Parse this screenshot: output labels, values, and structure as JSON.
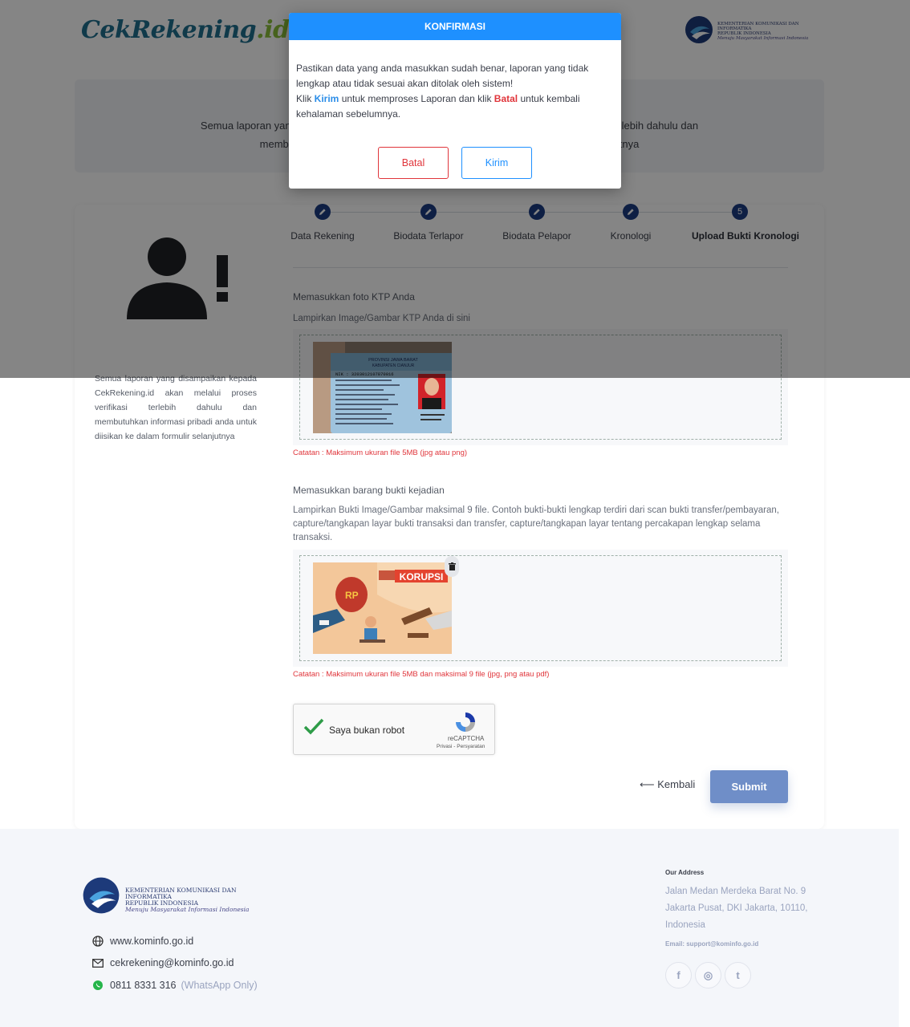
{
  "header": {
    "logo_main": "CekRekening",
    "logo_suffix": ".id",
    "ministry_line1": "KEMENTERIAN KOMUNIKASI DAN INFORMATIKA",
    "ministry_line2": "REPUBLIK INDONESIA",
    "ministry_slogan": "Menuju Masyarakat Informasi Indonesia"
  },
  "banner": {
    "line1_start": "Semua laporan yan",
    "line1_end": "lebih dahulu dan",
    "line2_start": "memb",
    "line2_end": "tnya"
  },
  "sidebar": {
    "text": "Semua laporan yang disampaikan kepada CekRekening.id akan melalui proses verifikasi terlebih dahulu dan membutuhkan informasi pribadi anda untuk diisikan ke dalam formulir selanjutnya"
  },
  "stepper": {
    "steps": [
      {
        "label": "Data Rekening",
        "state": "done"
      },
      {
        "label": "Biodata Terlapor",
        "state": "done"
      },
      {
        "label": "Biodata Pelapor",
        "state": "done"
      },
      {
        "label": "Kronologi",
        "state": "done"
      },
      {
        "label": "Upload Bukti Kronologi",
        "state": "active",
        "number": "5"
      }
    ]
  },
  "ktp": {
    "title": "Memasukkan foto KTP Anda",
    "desc": "Lampirkan Image/Gambar KTP Anda di sini",
    "note": "Catatan : Maksimum ukuran file 5MB (jpg atau png)",
    "card_header": "PROVINSI JAWA BARAT",
    "card_sub": "KABUPATEN CIANJUR",
    "card_nik": "NIK   :  3203012107870016"
  },
  "evidence": {
    "title": "Memasukkan barang bukti kejadian",
    "desc": "Lampirkan Bukti Image/Gambar maksimal 9 file. Contoh bukti-bukti lengkap terdiri dari scan bukti transfer/pembayaran, capture/tangkapan layar bukti transaksi dan transfer, capture/tangkapan layar tentang percakapan lengkap selama transaksi.",
    "note": "Catatan : Maksimum ukuran file 5MB dan maksimal 9 file (jpg, png atau pdf)",
    "image_caption": "KORUPSI",
    "bag_label": "RP"
  },
  "captcha": {
    "label": "Saya bukan robot",
    "brand": "reCAPTCHA",
    "links": "Privasi - Persyaratan"
  },
  "actions": {
    "back": "⟵ Kembali",
    "submit": "Submit"
  },
  "footer": {
    "ministry_line1": "KEMENTERIAN KOMUNIKASI DAN INFORMATIKA",
    "ministry_line2": "REPUBLIK INDONESIA",
    "ministry_slogan": "Menuju Masyarakat Informasi Indonesia",
    "website": "www.kominfo.go.id",
    "email": "cekrekening@kominfo.go.id",
    "phone": "0811 8331 316",
    "phone_note": "(WhatsApp Only)",
    "address_title": "Our Address",
    "address": "Jalan Medan Merdeka Barat No. 9 Jakarta Pusat, DKI Jakarta, 10110, Indonesia",
    "address_email": "Email: support@kominfo.go.id",
    "social_facebook": "f",
    "social_instagram": "◎",
    "social_twitter": "t"
  },
  "modal": {
    "title": "KONFIRMASI",
    "p1": "Pastikan data yang anda masukkan sudah benar, laporan yang tidak lengkap atau tidak sesuai akan ditolak oleh sistem!",
    "p2_klik": "Klik ",
    "p2_kirim": "Kirim",
    "p2_mid": " untuk memproses Laporan dan klik ",
    "p2_batal": "Batal",
    "p2_end": " untuk kembali kehalaman sebelumnya.",
    "cancel": "Batal",
    "submit": "Kirim"
  },
  "colors": {
    "primary": "#1e90ff",
    "danger": "#e0353b",
    "step": "#1c3c82",
    "submit": "#6f8ec8"
  }
}
